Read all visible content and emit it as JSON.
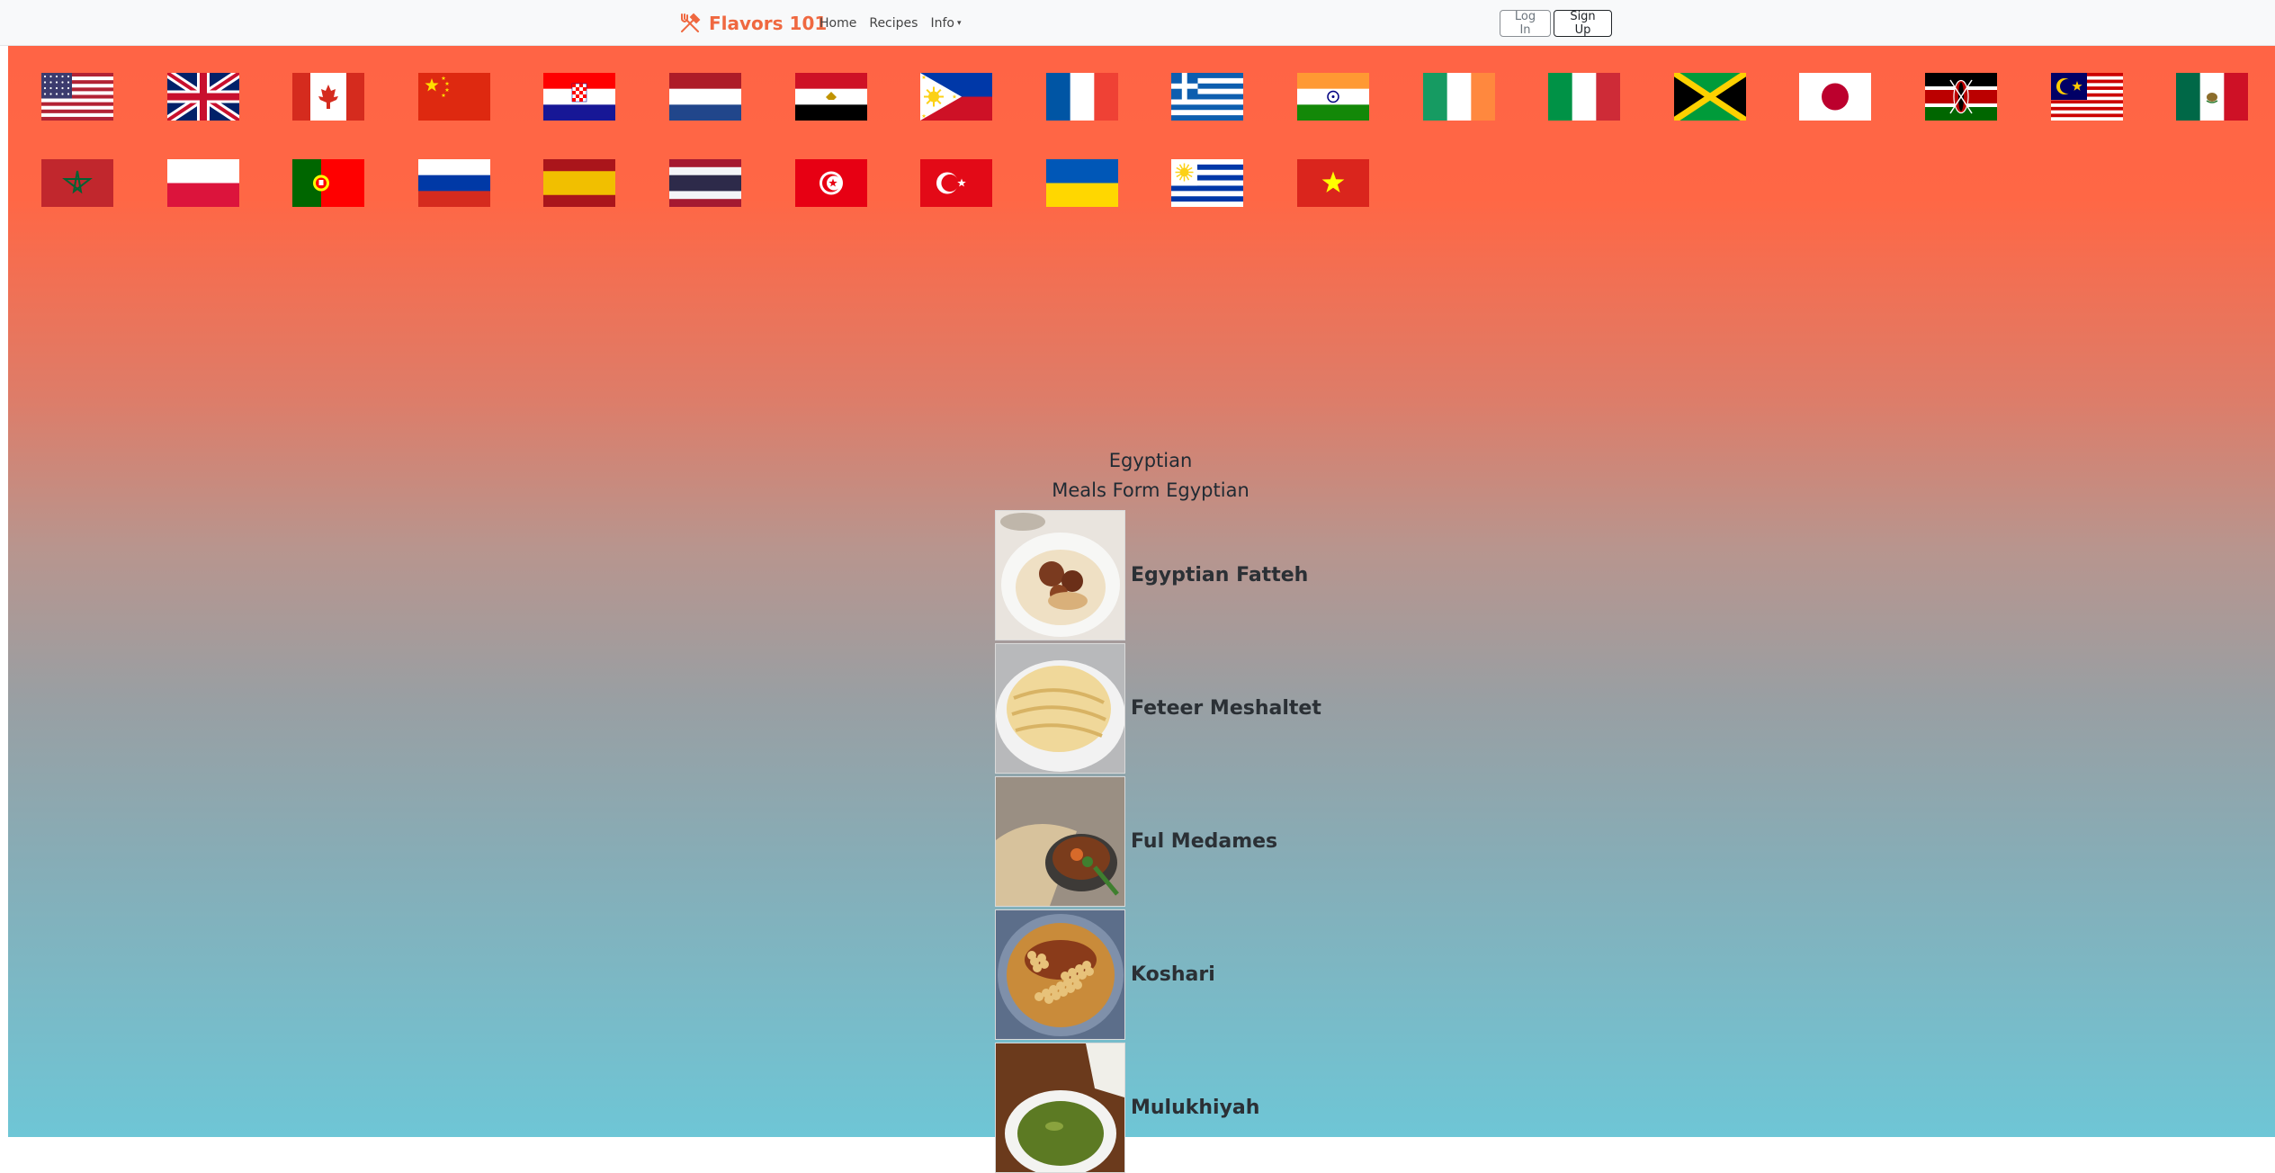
{
  "navbar": {
    "brand": "Flavors 101",
    "links": [
      {
        "label": "Home"
      },
      {
        "label": "Recipes"
      },
      {
        "label": "Info",
        "dropdown": true
      }
    ],
    "login_label": "Log In",
    "signup_label": "Sign Up",
    "accent": "#ef6840"
  },
  "flags": [
    {
      "country": "United States",
      "icon": "us-flag-icon"
    },
    {
      "country": "United Kingdom",
      "icon": "uk-flag-icon"
    },
    {
      "country": "Canada",
      "icon": "canada-flag-icon"
    },
    {
      "country": "China",
      "icon": "china-flag-icon"
    },
    {
      "country": "Croatia",
      "icon": "croatia-flag-icon"
    },
    {
      "country": "Netherlands",
      "icon": "netherlands-flag-icon"
    },
    {
      "country": "Egypt",
      "icon": "egypt-flag-icon"
    },
    {
      "country": "Philippines",
      "icon": "philippines-flag-icon"
    },
    {
      "country": "France",
      "icon": "france-flag-icon"
    },
    {
      "country": "Greece",
      "icon": "greece-flag-icon"
    },
    {
      "country": "India",
      "icon": "india-flag-icon"
    },
    {
      "country": "Ireland",
      "icon": "ireland-flag-icon"
    },
    {
      "country": "Italy",
      "icon": "italy-flag-icon"
    },
    {
      "country": "Jamaica",
      "icon": "jamaica-flag-icon"
    },
    {
      "country": "Japan",
      "icon": "japan-flag-icon"
    },
    {
      "country": "Kenya",
      "icon": "kenya-flag-icon"
    },
    {
      "country": "Malaysia",
      "icon": "malaysia-flag-icon"
    },
    {
      "country": "Mexico",
      "icon": "mexico-flag-icon"
    },
    {
      "country": "Morocco",
      "icon": "morocco-flag-icon"
    },
    {
      "country": "Poland",
      "icon": "poland-flag-icon"
    },
    {
      "country": "Portugal",
      "icon": "portugal-flag-icon"
    },
    {
      "country": "Russia",
      "icon": "russia-flag-icon"
    },
    {
      "country": "Spain",
      "icon": "spain-flag-icon"
    },
    {
      "country": "Thailand",
      "icon": "thailand-flag-icon"
    },
    {
      "country": "Tunisia",
      "icon": "tunisia-flag-icon"
    },
    {
      "country": "Turkey",
      "icon": "turkey-flag-icon"
    },
    {
      "country": "Ukraine",
      "icon": "ukraine-flag-icon"
    },
    {
      "country": "Uruguay",
      "icon": "uruguay-flag-icon"
    },
    {
      "country": "Vietnam",
      "icon": "vietnam-flag-icon"
    }
  ],
  "selection": {
    "title": "Egyptian",
    "subtitle": "Meals Form Egyptian"
  },
  "meals": [
    {
      "name": "Egyptian Fatteh",
      "image": "fatteh-photo"
    },
    {
      "name": "Feteer Meshaltet",
      "image": "feteer-photo"
    },
    {
      "name": "Ful Medames",
      "image": "ful-medames-photo"
    },
    {
      "name": "Koshari",
      "image": "koshari-photo"
    },
    {
      "name": "Mulukhiyah",
      "image": "mulukhiyah-photo"
    }
  ]
}
